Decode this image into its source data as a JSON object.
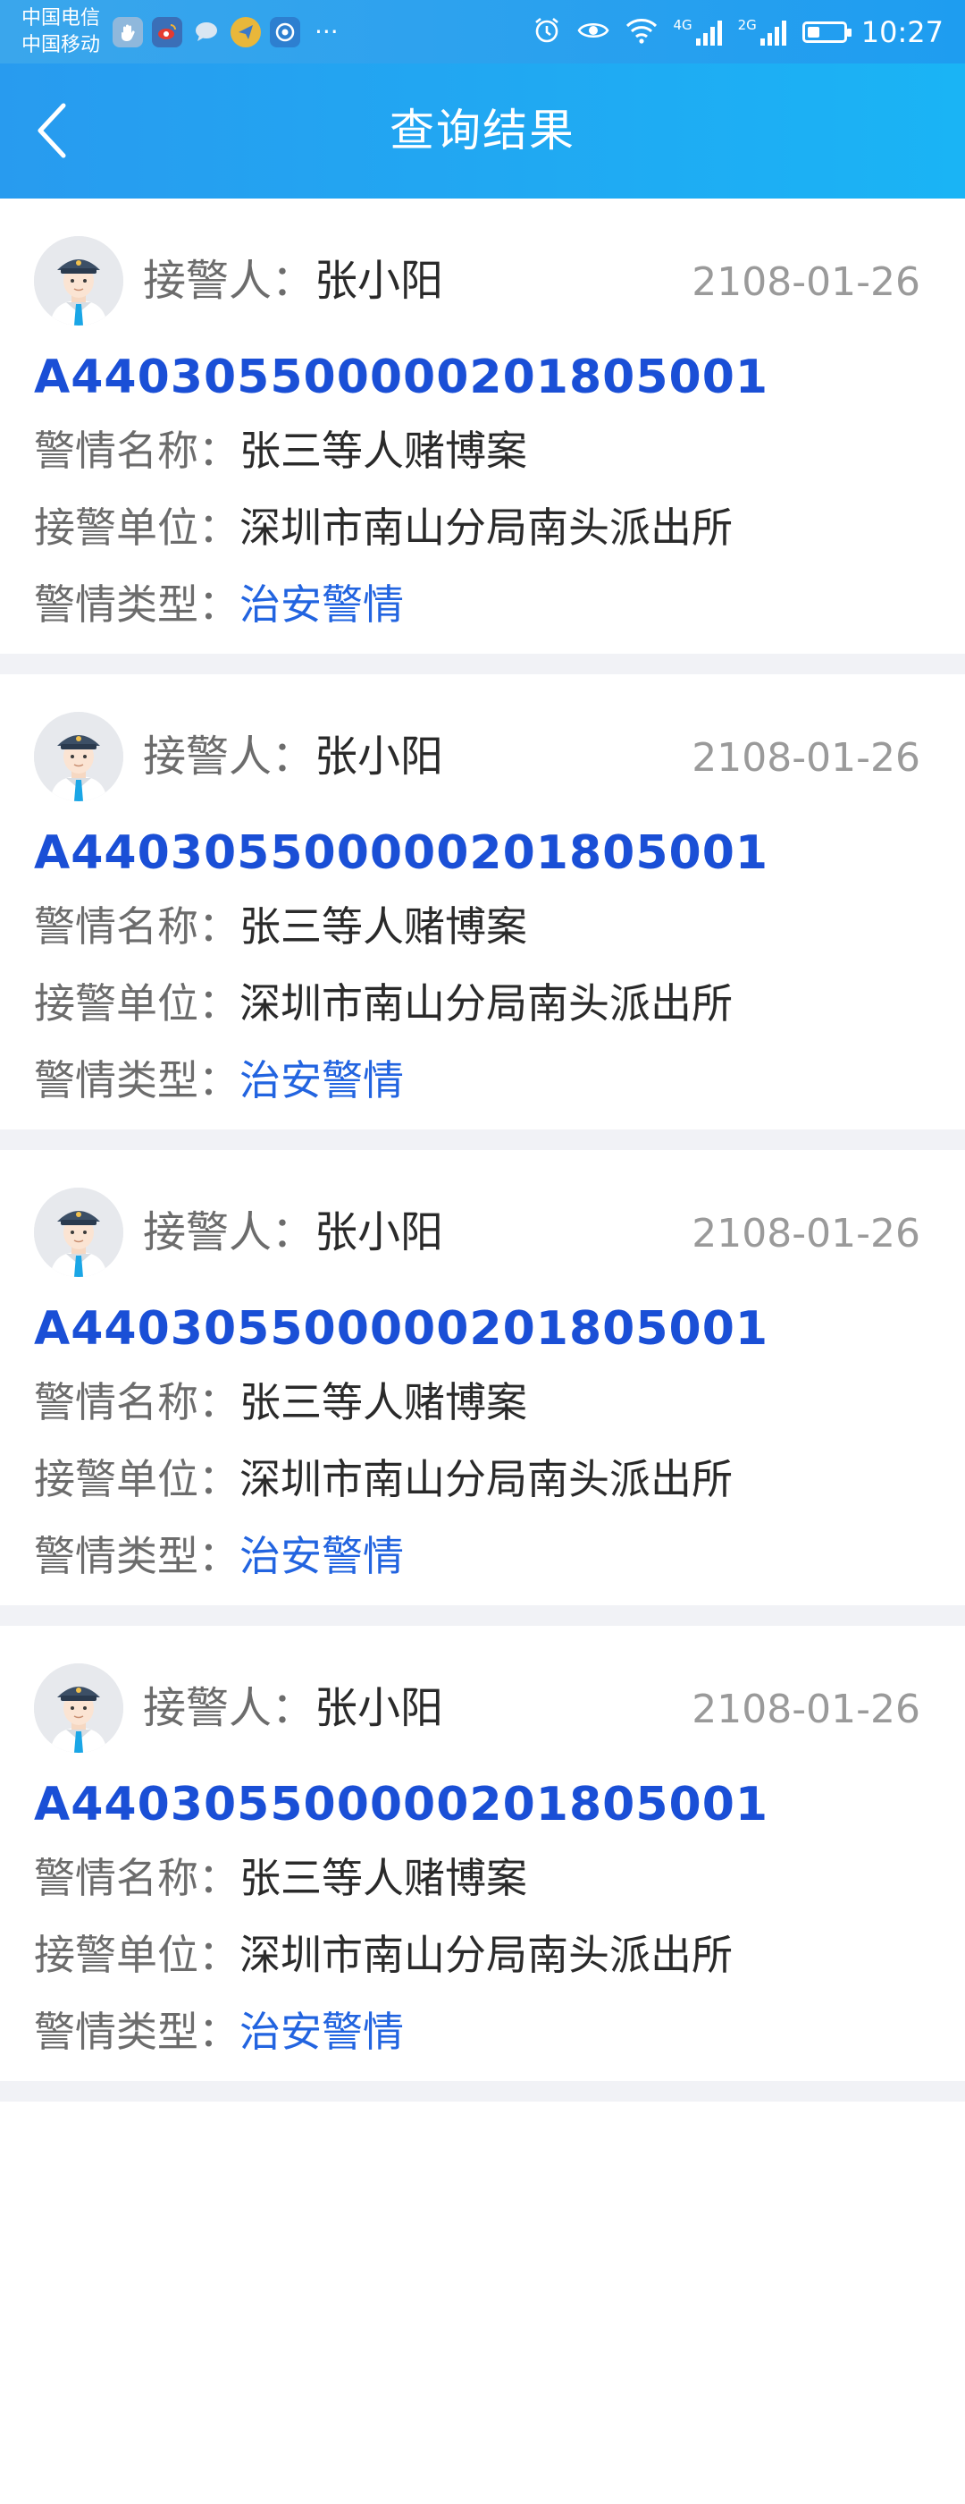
{
  "status_bar": {
    "carrier_1": "中国电信",
    "carrier_2": "中国移动",
    "left_icons": [
      "hand-icon",
      "weibo-icon",
      "chat-icon",
      "send-icon",
      "app-icon"
    ],
    "dots": "···",
    "right_icons": [
      "alarm-icon",
      "eye-icon",
      "wifi-icon",
      "signal-4g-icon",
      "signal-2g-icon",
      "battery-icon"
    ],
    "network_4g": "4G",
    "network_2g": "2G",
    "battery_level": 0.35,
    "time": "10:27"
  },
  "nav": {
    "title": "查询结果",
    "back_icon": "chevron-left-icon"
  },
  "colors": {
    "nav_start": "#289bef",
    "nav_end": "#1ab4f5",
    "case_number": "#1a4fd6",
    "type_accent": "#2264e0",
    "separator": "#f1f2f6"
  },
  "records": [
    {
      "officer_label": "接警人：",
      "officer_name": "张小阳",
      "date": "2108-01-26",
      "case_number": "A440305500000201805001",
      "name_label": "警情名称：",
      "name_value": "张三等人赌博案",
      "unit_label": "接警单位：",
      "unit_value": "深圳市南山分局南头派出所",
      "type_label": "警情类型：",
      "type_value": "治安警情"
    },
    {
      "officer_label": "接警人：",
      "officer_name": "张小阳",
      "date": "2108-01-26",
      "case_number": "A440305500000201805001",
      "name_label": "警情名称：",
      "name_value": "张三等人赌博案",
      "unit_label": "接警单位：",
      "unit_value": "深圳市南山分局南头派出所",
      "type_label": "警情类型：",
      "type_value": "治安警情"
    },
    {
      "officer_label": "接警人：",
      "officer_name": "张小阳",
      "date": "2108-01-26",
      "case_number": "A440305500000201805001",
      "name_label": "警情名称：",
      "name_value": "张三等人赌博案",
      "unit_label": "接警单位：",
      "unit_value": "深圳市南山分局南头派出所",
      "type_label": "警情类型：",
      "type_value": "治安警情"
    },
    {
      "officer_label": "接警人：",
      "officer_name": "张小阳",
      "date": "2108-01-26",
      "case_number": "A440305500000201805001",
      "name_label": "警情名称：",
      "name_value": "张三等人赌博案",
      "unit_label": "接警单位：",
      "unit_value": "深圳市南山分局南头派出所",
      "type_label": "警情类型：",
      "type_value": "治安警情"
    }
  ]
}
